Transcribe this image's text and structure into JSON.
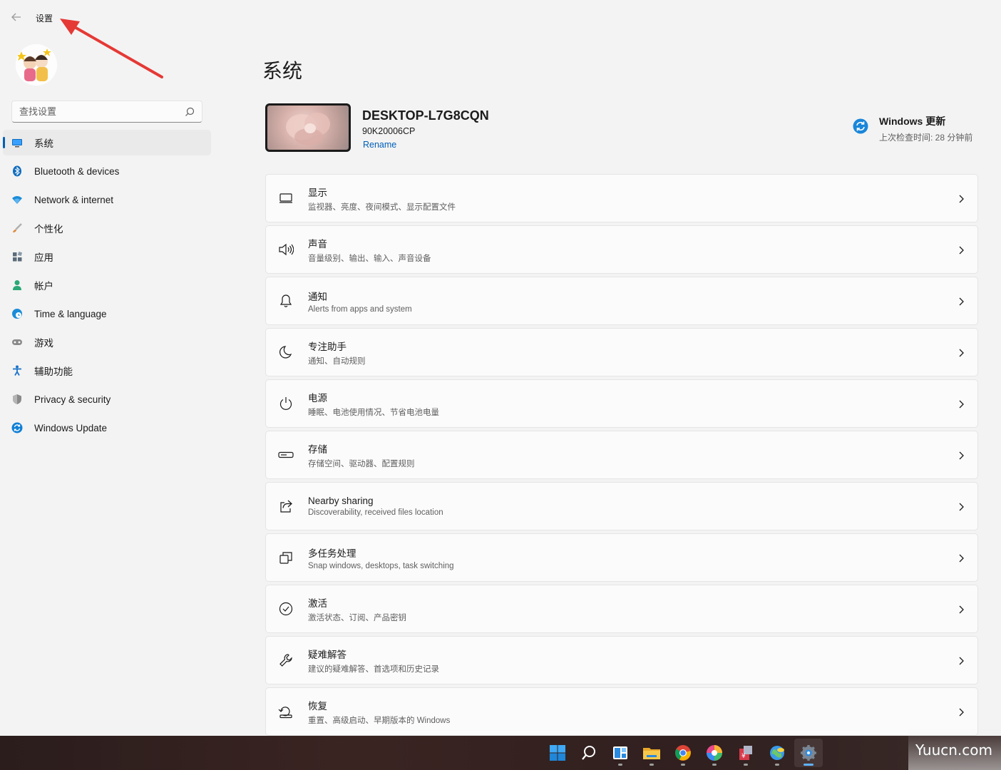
{
  "window": {
    "title": "设置",
    "back_icon": "back-arrow-icon"
  },
  "search": {
    "placeholder": "查找设置"
  },
  "sidebar": {
    "items": [
      {
        "label": "系统",
        "icon": "system-display-icon",
        "active": true,
        "color": "#0067c0"
      },
      {
        "label": "Bluetooth & devices",
        "icon": "bluetooth-icon",
        "color": "#0067c0"
      },
      {
        "label": "Network & internet",
        "icon": "wifi-icon",
        "color": "#1a8cd8"
      },
      {
        "label": "个性化",
        "icon": "brush-icon",
        "color": "#e08a3c"
      },
      {
        "label": "应用",
        "icon": "apps-icon",
        "color": "#5b6b7a"
      },
      {
        "label": "帐户",
        "icon": "account-icon",
        "color": "#2aa876"
      },
      {
        "label": "Time & language",
        "icon": "globe-clock-icon",
        "color": "#1a8cd8"
      },
      {
        "label": "游戏",
        "icon": "gamepad-icon",
        "color": "#7a7a7a"
      },
      {
        "label": "辅助功能",
        "icon": "accessibility-icon",
        "color": "#1a73c9"
      },
      {
        "label": "Privacy & security",
        "icon": "shield-icon",
        "color": "#7a7a7a"
      },
      {
        "label": "Windows Update",
        "icon": "update-sync-icon",
        "color": "#0f7fd6"
      }
    ]
  },
  "main": {
    "title": "系统",
    "device": {
      "name": "DESKTOP-L7G8CQN",
      "model": "90K20006CP",
      "rename": "Rename"
    },
    "update": {
      "title": "Windows 更新",
      "status": "上次检查时间: 28 分钟前"
    },
    "cards": [
      {
        "title": "显示",
        "sub": "监视器、亮度、夜间模式、显示配置文件",
        "icon": "monitor-icon"
      },
      {
        "title": "声音",
        "sub": "音量级别、输出、输入、声音设备",
        "icon": "speaker-icon"
      },
      {
        "title": "通知",
        "sub": "Alerts from apps and system",
        "icon": "bell-icon"
      },
      {
        "title": "专注助手",
        "sub": "通知、自动规则",
        "icon": "moon-icon"
      },
      {
        "title": "电源",
        "sub": "睡眠、电池使用情况、节省电池电量",
        "icon": "power-icon"
      },
      {
        "title": "存储",
        "sub": "存储空间、驱动器、配置规则",
        "icon": "storage-drive-icon"
      },
      {
        "title": "Nearby sharing",
        "sub": "Discoverability, received files location",
        "icon": "share-icon"
      },
      {
        "title": "多任务处理",
        "sub": "Snap windows, desktops, task switching",
        "icon": "multitask-icon"
      },
      {
        "title": "激活",
        "sub": "激活状态、订阅、产品密钥",
        "icon": "check-circle-icon"
      },
      {
        "title": "疑难解答",
        "sub": "建议的疑难解答、首选项和历史记录",
        "icon": "wrench-icon"
      },
      {
        "title": "恢复",
        "sub": "重置、高级启动、早期版本的 Windows",
        "icon": "recovery-icon"
      }
    ]
  },
  "taskbar": {
    "icons": [
      "start-icon",
      "search-icon",
      "widgets-icon",
      "file-explorer-icon",
      "chrome-icon",
      "browser-icon",
      "tool-app-icon",
      "globe-app-icon",
      "settings-gear-icon"
    ],
    "active": "settings-gear-icon"
  },
  "watermark": "Yuucn.com",
  "colors": {
    "accent": "#005fb8",
    "annotation_arrow": "#e53935"
  }
}
